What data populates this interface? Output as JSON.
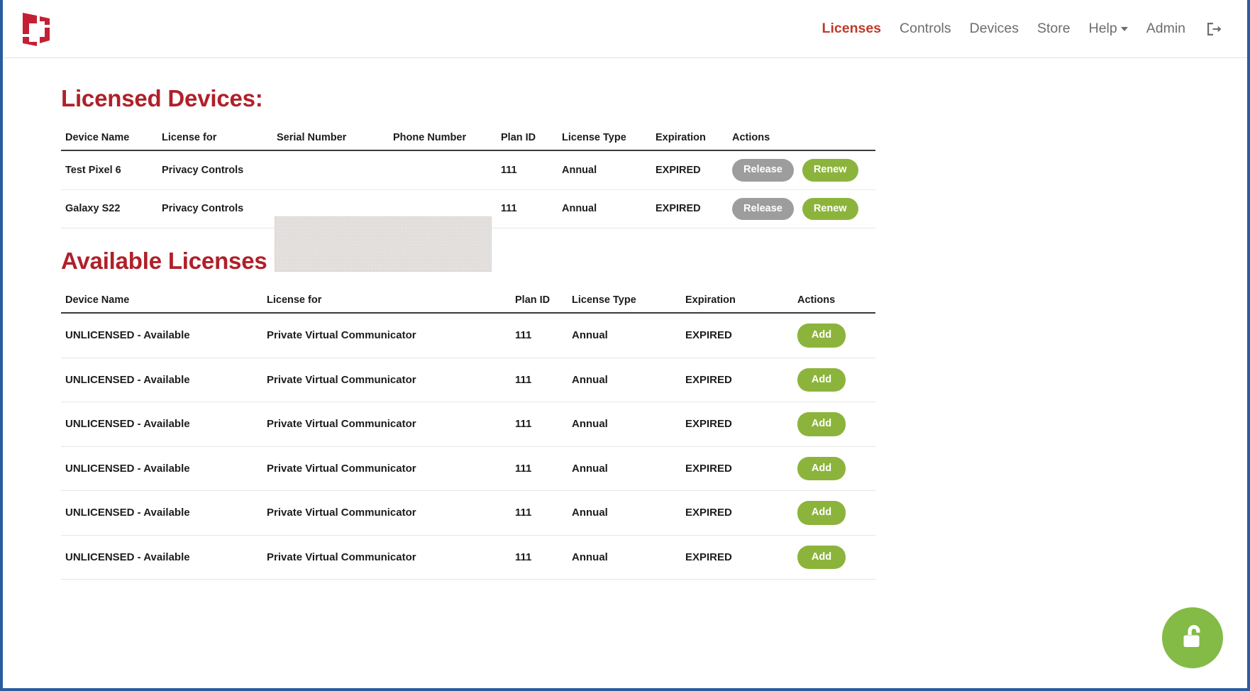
{
  "brand": {
    "logo_icon": "company-logo-icon",
    "logo_color": "#c42033"
  },
  "nav": {
    "items": [
      {
        "label": "Licenses",
        "active": true,
        "has_caret": false
      },
      {
        "label": "Controls",
        "active": false,
        "has_caret": false
      },
      {
        "label": "Devices",
        "active": false,
        "has_caret": false
      },
      {
        "label": "Store",
        "active": false,
        "has_caret": false
      },
      {
        "label": "Help",
        "active": false,
        "has_caret": true
      },
      {
        "label": "Admin",
        "active": false,
        "has_caret": false
      }
    ],
    "logout_icon": "logout-icon",
    "active_color": "#c0392b",
    "inactive_color": "#6d6d6d"
  },
  "licensed": {
    "title": "Licensed Devices:",
    "headers": [
      "Device Name",
      "License for",
      "Serial Number",
      "Phone Number",
      "Plan ID",
      "License Type",
      "Expiration",
      "Actions"
    ],
    "rows": [
      {
        "device_name": "Test Pixel 6",
        "license_for": "Privacy Controls",
        "serial_number": "",
        "phone_number": "",
        "plan_id": "111",
        "license_type": "Annual",
        "expiration": "EXPIRED",
        "release_label": "Release",
        "renew_label": "Renew"
      },
      {
        "device_name": "Galaxy S22",
        "license_for": "Privacy Controls",
        "serial_number": "",
        "phone_number": "",
        "plan_id": "111",
        "license_type": "Annual",
        "expiration": "EXPIRED",
        "release_label": "Release",
        "renew_label": "Renew"
      }
    ],
    "redaction_note": "serial-and-phone-columns-redacted"
  },
  "available": {
    "title": "Available Licenses",
    "headers": [
      "Device Name",
      "License for",
      "Plan ID",
      "License Type",
      "Expiration",
      "Actions"
    ],
    "rows": [
      {
        "device_name": "UNLICENSED - Available",
        "license_for": "Private Virtual Communicator",
        "plan_id": "111",
        "license_type": "Annual",
        "expiration": "EXPIRED",
        "add_label": "Add"
      },
      {
        "device_name": "UNLICENSED - Available",
        "license_for": "Private Virtual Communicator",
        "plan_id": "111",
        "license_type": "Annual",
        "expiration": "EXPIRED",
        "add_label": "Add"
      },
      {
        "device_name": "UNLICENSED - Available",
        "license_for": "Private Virtual Communicator",
        "plan_id": "111",
        "license_type": "Annual",
        "expiration": "EXPIRED",
        "add_label": "Add"
      },
      {
        "device_name": "UNLICENSED - Available",
        "license_for": "Private Virtual Communicator",
        "plan_id": "111",
        "license_type": "Annual",
        "expiration": "EXPIRED",
        "add_label": "Add"
      },
      {
        "device_name": "UNLICENSED - Available",
        "license_for": "Private Virtual Communicator",
        "plan_id": "111",
        "license_type": "Annual",
        "expiration": "EXPIRED",
        "add_label": "Add"
      },
      {
        "device_name": "UNLICENSED - Available",
        "license_for": "Private Virtual Communicator",
        "plan_id": "111",
        "license_type": "Annual",
        "expiration": "EXPIRED",
        "add_label": "Add"
      }
    ]
  },
  "fab": {
    "icon": "unlock-icon",
    "color": "#83bb46"
  },
  "theme": {
    "heading_red": "#b02029",
    "button_green": "#8cb43c",
    "button_gray": "#9d9d9d",
    "window_chrome_blue": "#2a5d9f"
  }
}
